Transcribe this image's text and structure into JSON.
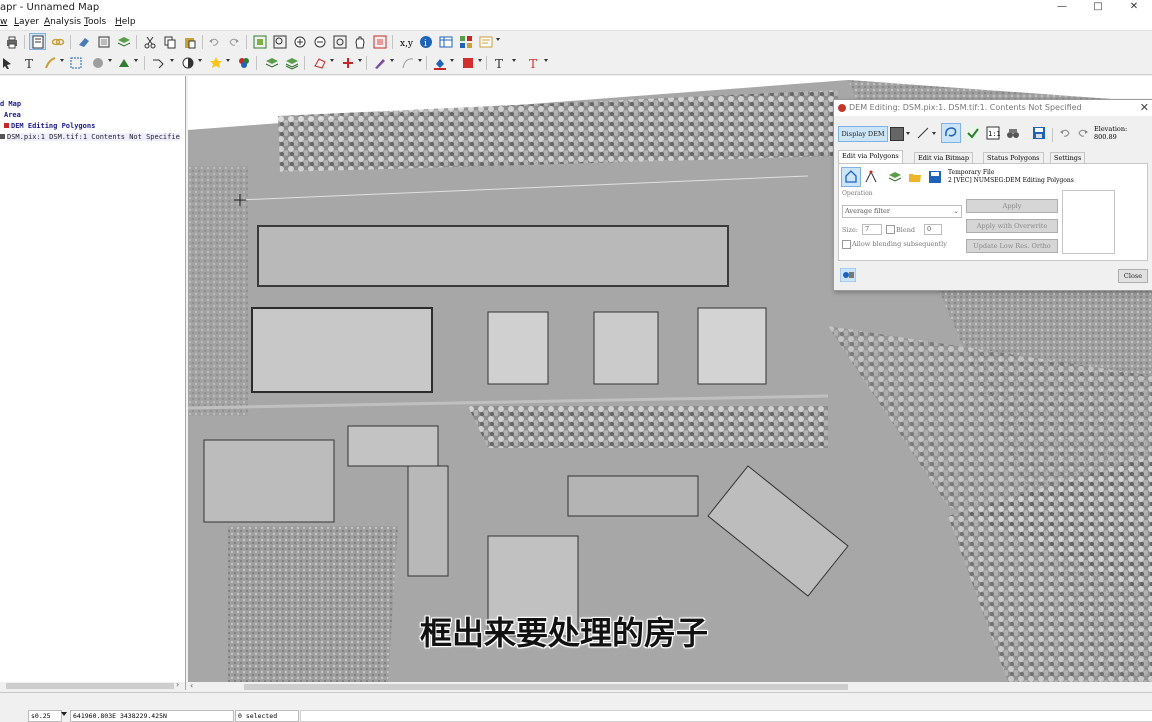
{
  "window": {
    "title": "apr - Unnamed Map",
    "controls": [
      "minimize-icon",
      "maximize-icon",
      "close-icon"
    ]
  },
  "menu": [
    {
      "prefix": "",
      "accel": "w",
      "rest": ""
    },
    {
      "prefix": "",
      "accel": "L",
      "rest": "ayer"
    },
    {
      "prefix": "",
      "accel": "A",
      "rest": "nalysis"
    },
    {
      "prefix": "",
      "accel": "T",
      "rest": "ools"
    },
    {
      "prefix": "",
      "accel": "H",
      "rest": "elp"
    }
  ],
  "toolbar_row1_icons": [
    "print-icon",
    "page-setup-icon",
    "link-icon",
    "eraser-icon",
    "frame-icon",
    "layers-icon",
    "cut-icon",
    "copy-icon",
    "paste-icon",
    "undo-icon",
    "redo-icon",
    "zoom-extent-icon",
    "zoom-box-icon",
    "zoom-in-icon",
    "zoom-out-icon",
    "zoom-full-icon",
    "pan-hand-icon",
    "zoom-layer-icon",
    "coordinate-xy-icon",
    "info-icon",
    "attribute-table-icon",
    "grid-icon",
    "legend-icon"
  ],
  "toolbar_row2_icons": [
    "arrow-icon",
    "text-tool-icon",
    "paint-icon",
    "select-grid-icon",
    "shape-icon",
    "vertex-icon",
    "north-arrow-icon",
    "circle-icon",
    "star-icon",
    "color-circles-icon",
    "stack-icon",
    "stack-edit-icon",
    "polygon-select-icon",
    "plus-icon",
    "pen-icon",
    "curve-icon",
    "fill-color-icon",
    "red-square-icon",
    "text-style-icon",
    "text-color-icon"
  ],
  "layer_tree": {
    "items": [
      {
        "text": "d Map"
      },
      {
        "text": "Area"
      },
      {
        "text": "DEM Editing Polygons"
      },
      {
        "text": "DSM.pix:1  DSM.tif:1  Contents Not Specifie"
      }
    ]
  },
  "map": {
    "subtitle": "框出来要处理的房子"
  },
  "dem_dialog": {
    "title": "DEM Editing: DSM.pix:1. DSM.tif:1. Contents Not Specified",
    "display_button": "Display DEM",
    "elevation_label": "Elevation:",
    "elevation_value": "800.89",
    "tabs": [
      "Edit via Polygons",
      "Edit via Bitmap",
      "Status Polygons",
      "Settings"
    ],
    "temp_file_label": "Temporary File",
    "temp_file_value": "2 [VEC] NUMSEG:DEM Editing Polygons",
    "operation_label": "Operation",
    "operation_value": "Average filter",
    "size_label": "Size:",
    "size_value": "7",
    "blend_label": "Blend",
    "blend_value": "0",
    "allow_blending_label": "Allow blending subsequently",
    "apply_button": "Apply",
    "apply_overwrite_button": "Apply with Overwrite",
    "update_button": "Update Low Res. Ortho",
    "close_button": "Close"
  },
  "status": {
    "scale": "s0.25",
    "coords": "641960.803E 3438229.425N",
    "selected": "0 selected"
  }
}
